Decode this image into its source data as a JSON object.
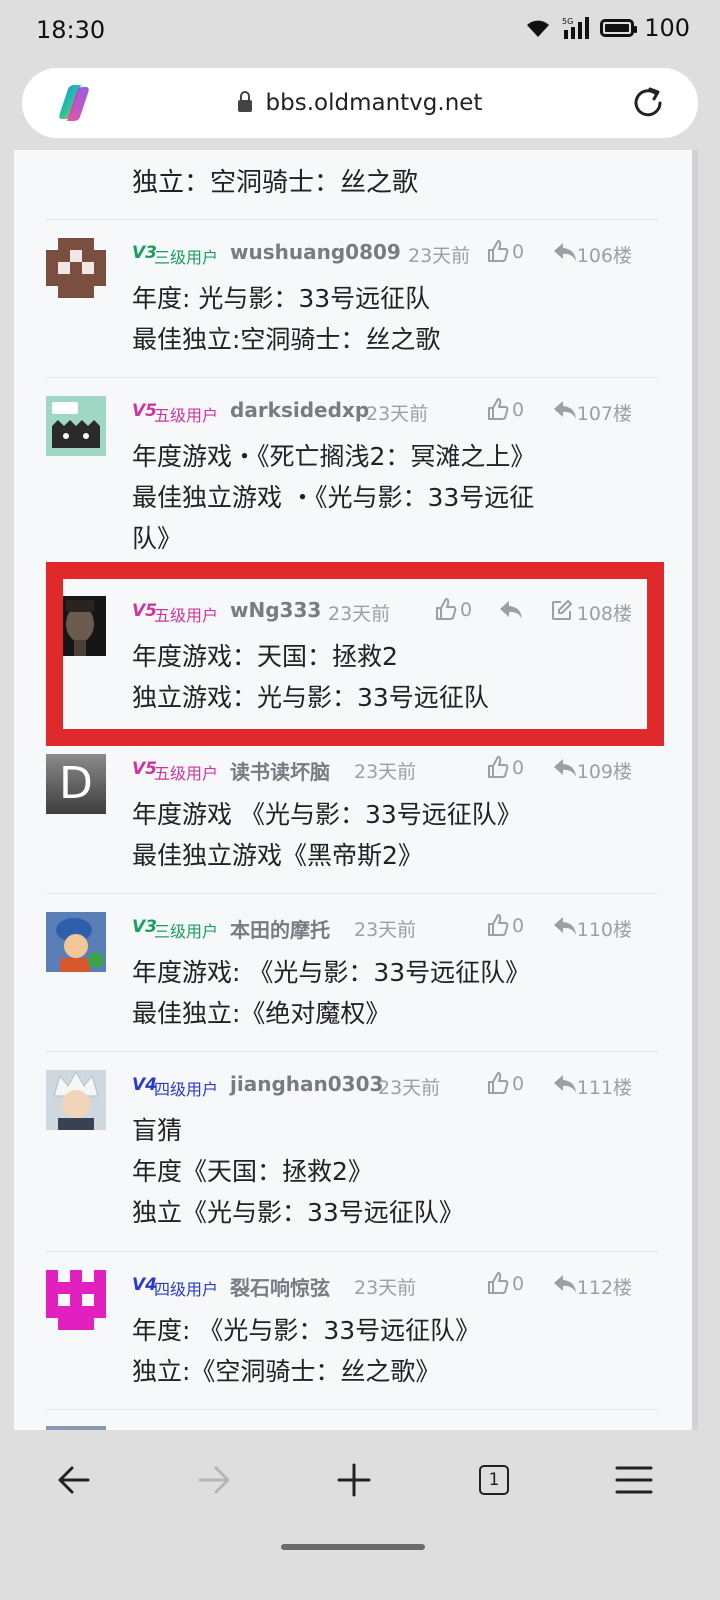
{
  "status": {
    "time": "18:30",
    "battery": "100",
    "network": "5G"
  },
  "browser": {
    "url": "bbs.oldmantvg.net",
    "tab_count": "1"
  },
  "top_fragment": "独立：空洞骑士：丝之歌",
  "posts": [
    {
      "level_tag": "V3",
      "level_title": "三级用户",
      "username": "wushuang0809",
      "time": "23天前",
      "likes": "0",
      "floor": "106楼",
      "lines": [
        "年度: 光与影：33号远征队",
        "最佳独立:空洞骑士：丝之歌"
      ]
    },
    {
      "level_tag": "V5",
      "level_title": "五级用户",
      "username": "darksidedxp",
      "time": "23天前",
      "likes": "0",
      "floor": "107楼",
      "lines": [
        "年度游戏・《死亡搁浅2：冥滩之上》",
        "最佳独立游戏 ・《光与影：33号远征",
        "队》"
      ]
    },
    {
      "level_tag": "V5",
      "level_title": "五级用户",
      "username": "wNg333",
      "time": "23天前",
      "likes": "0",
      "floor": "108楼",
      "lines": [
        "年度游戏：天国：拯救2",
        "独立游戏：光与影：33号远征队"
      ]
    },
    {
      "level_tag": "V5",
      "level_title": "五级用户",
      "username": "读书读坏脑",
      "time": "23天前",
      "likes": "0",
      "floor": "109楼",
      "avatar_letter": "D",
      "lines": [
        "年度游戏 《光与影：33号远征队》",
        "最佳独立游戏《黑帝斯2》"
      ]
    },
    {
      "level_tag": "V3",
      "level_title": "三级用户",
      "username": "本田的摩托",
      "time": "23天前",
      "likes": "0",
      "floor": "110楼",
      "lines": [
        "年度游戏: 《光与影：33号远征队》",
        "最佳独立:《绝对魔权》"
      ]
    },
    {
      "level_tag": "V4",
      "level_title": "四级用户",
      "username": "jianghan0303",
      "time": "23天前",
      "likes": "0",
      "floor": "111楼",
      "lines": [
        "盲猜",
        "年度《天国：拯救2》",
        "独立《光与影：33号远征队》"
      ]
    },
    {
      "level_tag": "V4",
      "level_title": "四级用户",
      "username": "裂石响惊弦",
      "time": "23天前",
      "likes": "0",
      "floor": "112楼",
      "lines": [
        "年度: 《光与影：33号远征队》",
        "独立:《空洞骑士：丝之歌》"
      ]
    }
  ],
  "icons": {
    "like": "thumbs-up-icon",
    "reply": "reply-icon",
    "edit": "edit-icon",
    "back": "back-arrow-icon",
    "forward": "forward-arrow-icon",
    "new_tab": "plus-icon",
    "tabs": "tabs-icon",
    "menu": "menu-icon"
  },
  "colors": {
    "level3": "#17a05d",
    "level4": "#2b39c8",
    "level5": "#d0359b",
    "highlight": "#e0292b"
  }
}
